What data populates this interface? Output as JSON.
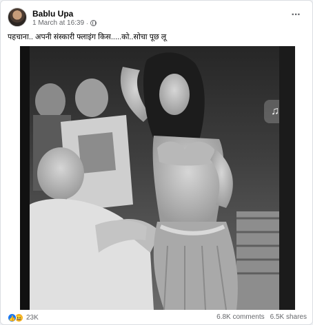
{
  "post": {
    "author": "Bablu Upa",
    "timestamp": "1 March at 16:39",
    "separator": "·",
    "privacy_icon": "globe-icon",
    "more_icon": "ellipsis-icon",
    "more_label": "···",
    "caption": "पहचाना.. अपनी संस्कारी फ्लाइंग किस.....को..सोचा पूछ लू"
  },
  "media": {
    "type": "black-and-white photo",
    "audio_icon": "music-note-icon",
    "audio_glyph": "♫"
  },
  "footer": {
    "like_icon": "like-reaction-icon",
    "like_glyph": "👍",
    "haha_icon": "haha-reaction-icon",
    "haha_glyph": "😆",
    "reaction_count": "23K",
    "comments": "6.8K comments",
    "shares": "6.5K shares"
  },
  "colors": {
    "accent": "#1877f2",
    "secondary_text": "#65676b",
    "card_bg": "#ffffff"
  }
}
